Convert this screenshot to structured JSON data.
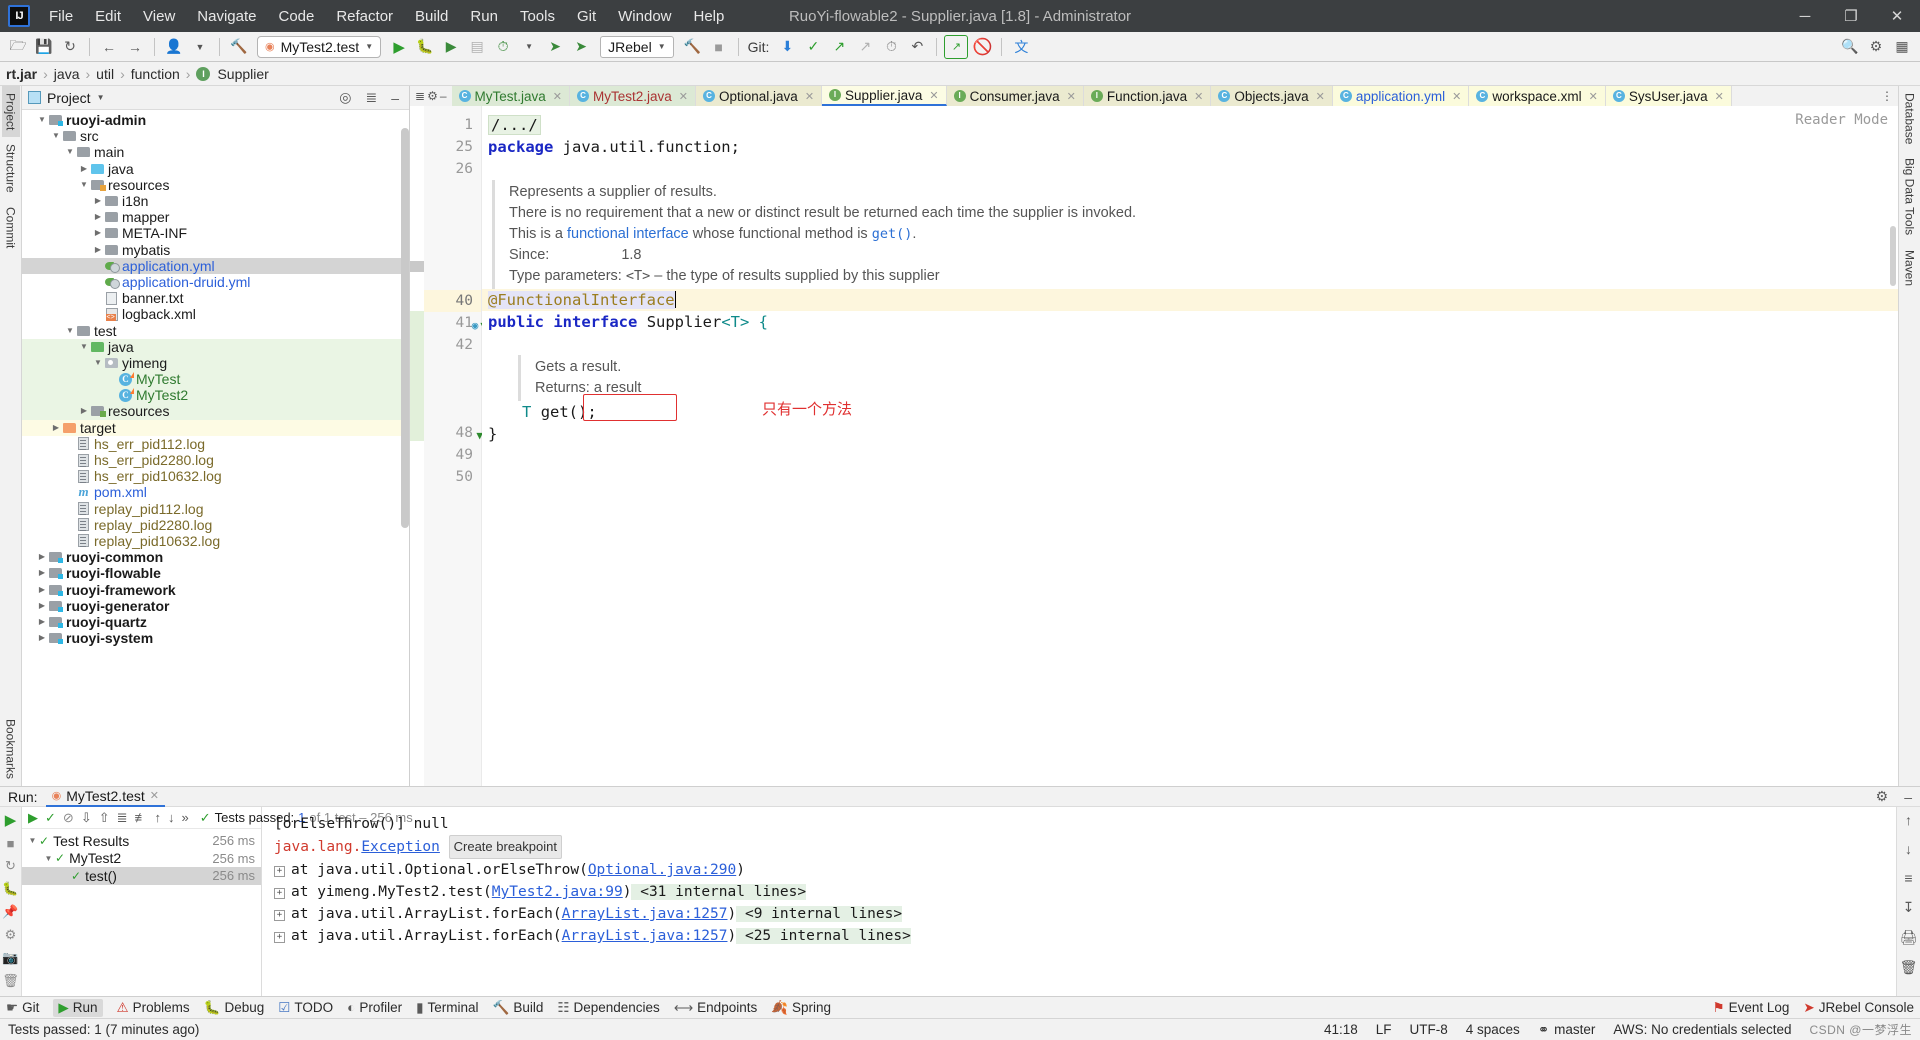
{
  "window": {
    "title": "RuoYi-flowable2 - Supplier.java [1.8] - Administrator",
    "minimize": "─",
    "maximize": "❐",
    "close": "✕"
  },
  "menubar": [
    "File",
    "Edit",
    "View",
    "Navigate",
    "Code",
    "Refactor",
    "Build",
    "Run",
    "Tools",
    "Git",
    "Window",
    "Help"
  ],
  "toolbar": {
    "open_icon": "open-folder-icon",
    "save_icon": "save-icon",
    "sync_icon": "sync-icon",
    "back_icon": "back-arrow-icon",
    "forward_icon": "forward-arrow-icon",
    "profile_icon": "user-profile-icon",
    "build_icon": "hammer-icon",
    "run_config": "MyTest2.test",
    "run_icon": "run-icon",
    "debug_icon": "debug-icon",
    "run_coverage_icon": "run-with-coverage-icon",
    "profiler_icon": "profiler-icon",
    "jrebel_label": "JRebel",
    "jrebel_run_icon": "jrebel-run-icon",
    "jrebel_debug_icon": "jrebel-debug-icon",
    "stop_icon": "stop-icon",
    "git_label": "Git:",
    "git_update_icon": "update-project-icon",
    "git_commit_icon": "commit-icon",
    "git_push_icon": "push-icon",
    "git_cherry_icon": "cherry-pick-icon",
    "history_icon": "history-icon",
    "rollback_icon": "rollback-icon",
    "search_everywhere_icon": "search-everywhere-icon",
    "settings_icon": "settings-icon",
    "project_structure_icon": "project-structure-icon",
    "translate_icon": "translate-icon"
  },
  "breadcrumb": {
    "items": [
      "rt.jar",
      "java",
      "util",
      "function"
    ],
    "current": "Supplier",
    "separator": "›"
  },
  "left_rail": [
    "Project",
    "Structure",
    "Commit",
    "Bookmarks"
  ],
  "right_rail": [
    "Database",
    "Big Data Tools",
    "Maven"
  ],
  "project_panel": {
    "title": "Project",
    "dropdown_icon": "chevron-down-icon",
    "locate_icon": "select-opened-file-icon",
    "collapse_icon": "collapse-all-icon",
    "hide_icon": "hide-icon",
    "tree": [
      {
        "depth": 1,
        "label": "ruoyi-admin",
        "icon": "module-folder",
        "arrow": "down",
        "style": "bold"
      },
      {
        "depth": 2,
        "label": "src",
        "icon": "folder",
        "arrow": "down",
        "style": ""
      },
      {
        "depth": 3,
        "label": "main",
        "icon": "folder",
        "arrow": "down",
        "style": ""
      },
      {
        "depth": 4,
        "label": "java",
        "icon": "source-folder",
        "arrow": "right",
        "style": ""
      },
      {
        "depth": 4,
        "label": "resources",
        "icon": "resource-folder",
        "arrow": "down",
        "style": ""
      },
      {
        "depth": 5,
        "label": "i18n",
        "icon": "folder",
        "arrow": "right",
        "style": ""
      },
      {
        "depth": 5,
        "label": "mapper",
        "icon": "folder",
        "arrow": "right",
        "style": ""
      },
      {
        "depth": 5,
        "label": "META-INF",
        "icon": "folder",
        "arrow": "right",
        "style": ""
      },
      {
        "depth": 5,
        "label": "mybatis",
        "icon": "folder",
        "arrow": "right",
        "style": ""
      },
      {
        "depth": 5,
        "label": "application.yml",
        "icon": "yml-file",
        "arrow": "",
        "style": "link",
        "selected": true
      },
      {
        "depth": 5,
        "label": "application-druid.yml",
        "icon": "yml-file",
        "arrow": "",
        "style": "link"
      },
      {
        "depth": 5,
        "label": "banner.txt",
        "icon": "txt-file",
        "arrow": "",
        "style": ""
      },
      {
        "depth": 5,
        "label": "logback.xml",
        "icon": "xml-file",
        "arrow": "",
        "style": ""
      },
      {
        "depth": 3,
        "label": "test",
        "icon": "folder",
        "arrow": "down",
        "style": ""
      },
      {
        "depth": 4,
        "label": "java",
        "icon": "test-source-folder",
        "arrow": "down",
        "style": "",
        "row": "test"
      },
      {
        "depth": 5,
        "label": "yimeng",
        "icon": "package-folder",
        "arrow": "down",
        "style": "",
        "row": "test"
      },
      {
        "depth": 6,
        "label": "MyTest",
        "icon": "class-file",
        "arrow": "",
        "style": "green",
        "row": "test"
      },
      {
        "depth": 6,
        "label": "MyTest2",
        "icon": "class-file",
        "arrow": "",
        "style": "green",
        "row": "test"
      },
      {
        "depth": 4,
        "label": "resources",
        "icon": "test-resource-folder",
        "arrow": "right",
        "style": "",
        "row": "test"
      },
      {
        "depth": 2,
        "label": "target",
        "icon": "target-folder",
        "arrow": "right",
        "style": "",
        "row": "target"
      },
      {
        "depth": 3,
        "label": "hs_err_pid112.log",
        "icon": "log-file",
        "arrow": "",
        "style": "olive"
      },
      {
        "depth": 3,
        "label": "hs_err_pid2280.log",
        "icon": "log-file",
        "arrow": "",
        "style": "olive"
      },
      {
        "depth": 3,
        "label": "hs_err_pid10632.log",
        "icon": "log-file",
        "arrow": "",
        "style": "olive"
      },
      {
        "depth": 3,
        "label": "pom.xml",
        "icon": "maven-file",
        "arrow": "",
        "style": "link"
      },
      {
        "depth": 3,
        "label": "replay_pid112.log",
        "icon": "log-file",
        "arrow": "",
        "style": "olive"
      },
      {
        "depth": 3,
        "label": "replay_pid2280.log",
        "icon": "log-file",
        "arrow": "",
        "style": "olive"
      },
      {
        "depth": 3,
        "label": "replay_pid10632.log",
        "icon": "log-file",
        "arrow": "",
        "style": "olive"
      },
      {
        "depth": 1,
        "label": "ruoyi-common",
        "icon": "module-folder",
        "arrow": "right",
        "style": "bold"
      },
      {
        "depth": 1,
        "label": "ruoyi-flowable",
        "icon": "module-folder",
        "arrow": "right",
        "style": "bold"
      },
      {
        "depth": 1,
        "label": "ruoyi-framework",
        "icon": "module-folder",
        "arrow": "right",
        "style": "bold"
      },
      {
        "depth": 1,
        "label": "ruoyi-generator",
        "icon": "module-folder",
        "arrow": "right",
        "style": "bold"
      },
      {
        "depth": 1,
        "label": "ruoyi-quartz",
        "icon": "module-folder",
        "arrow": "right",
        "style": "bold"
      },
      {
        "depth": 1,
        "label": "ruoyi-system",
        "icon": "module-folder",
        "arrow": "right",
        "style": "bold"
      }
    ]
  },
  "editor": {
    "tabs": [
      {
        "label": "MyTest.java",
        "icon": "class-icon",
        "color": "green",
        "bg": "green",
        "active": false
      },
      {
        "label": "MyTest2.java",
        "icon": "class-icon",
        "color": "red",
        "bg": "green",
        "active": false
      },
      {
        "label": "Optional.java",
        "icon": "class-icon",
        "color": "dark",
        "bg": "yellow",
        "active": false
      },
      {
        "label": "Supplier.java",
        "icon": "interface-icon",
        "color": "dark",
        "bg": "active",
        "active": true
      },
      {
        "label": "Consumer.java",
        "icon": "interface-icon",
        "color": "dark",
        "bg": "yellow",
        "active": false
      },
      {
        "label": "Function.java",
        "icon": "interface-icon",
        "color": "dark",
        "bg": "yellow",
        "active": false
      },
      {
        "label": "Objects.java",
        "icon": "class-icon",
        "color": "dark",
        "bg": "yellow",
        "active": false
      },
      {
        "label": "application.yml",
        "icon": "yml-icon",
        "color": "blue",
        "bg": "lyellow",
        "active": false
      },
      {
        "label": "workspace.xml",
        "icon": "xml-icon",
        "color": "dark",
        "bg": "lyellow",
        "active": false
      },
      {
        "label": "SysUser.java",
        "icon": "class-icon",
        "color": "dark",
        "bg": "lyellow",
        "active": false
      }
    ],
    "more_icon": "more-tabs-icon",
    "reader_mode": "Reader Mode",
    "line_numbers": [
      "1",
      "25",
      "26",
      "",
      "",
      "",
      "",
      "",
      "40",
      "41",
      "42",
      "",
      "",
      "",
      "48",
      "49",
      "50"
    ],
    "gutter_lines": [
      {
        "num": "1"
      },
      {
        "num": "25"
      },
      {
        "num": "26"
      },
      {
        "num": "40",
        "current": true
      },
      {
        "num": "41",
        "icons": [
          "implemented-icon",
          "implementing-method-icon"
        ]
      },
      {
        "num": "42"
      },
      {
        "num": "48",
        "icons": [
          "implementing-method-icon"
        ]
      },
      {
        "num": "49"
      },
      {
        "num": "50"
      }
    ],
    "code": {
      "fold_placeholder": "/.../",
      "package_keyword": "package",
      "package_name": " java.util.function;",
      "javadoc_class": [
        "Represents a supplier of results.",
        "There is no requirement that a new or distinct result be returned each time the supplier is invoked.",
        "This is a functional interface whose functional method is get().",
        "Since:                1.8",
        "Type parameters:  <T> – the type of results supplied by this supplier"
      ],
      "javadoc_links": [
        "functional interface",
        "get()"
      ],
      "annotation": "@FunctionalInterface",
      "declaration_kw1": "public",
      "declaration_kw2": "interface",
      "declaration_name": "Supplier",
      "declaration_generic": "<T> {",
      "javadoc_method": [
        "Gets a result.",
        "Returns: a result"
      ],
      "method_signature": "T get();",
      "closing_brace": "}",
      "annotation_note": "只有一个方法"
    }
  },
  "run_panel": {
    "run_label": "Run:",
    "tab_label": "MyTest2.test",
    "tab_close_icon": "close-icon",
    "settings_icon": "gear-icon",
    "hide_icon": "hide-icon",
    "toolbar": {
      "rerun_icon": "rerun-icon",
      "toggle_passed_icon": "hide-passed-icon",
      "toggle_ignored_icon": "hide-ignored-icon",
      "sort_alpha_icon": "sort-alphabetically-icon",
      "sort_duration_icon": "sort-by-duration-icon",
      "expand_icon": "expand-all-icon",
      "collapse_icon": "collapse-all-icon",
      "prev_icon": "prev-failed-icon",
      "next_icon": "next-failed-icon",
      "more_icon": "more-icon"
    },
    "status": {
      "check_icon": "check-icon",
      "passed_label": "Tests passed:",
      "passed_detail": "1",
      "passed_rest": " of 1 test – 256 ms"
    },
    "tests": [
      {
        "depth": 0,
        "label": "Test Results",
        "time": "256 ms",
        "arrow": "down"
      },
      {
        "depth": 1,
        "label": "MyTest2",
        "time": "256 ms",
        "arrow": "down"
      },
      {
        "depth": 2,
        "label": "test()",
        "time": "256 ms",
        "arrow": "",
        "selected": true
      }
    ],
    "console": [
      {
        "text": "[orElseThrow()] null",
        "type": "plain"
      },
      {
        "text": "java.lang.Exception",
        "type": "exception",
        "chip": "Create breakpoint"
      },
      {
        "text": "at java.util.Optional.orElseThrow(Optional.java:290)",
        "type": "stack",
        "link": "Optional.java:290",
        "expander": true
      },
      {
        "text": "at yimeng.MyTest2.test(MyTest2.java:99) <31 internal lines>",
        "type": "stack",
        "link": "MyTest2.java:99",
        "tail": "<31 internal lines>",
        "expander": true
      },
      {
        "text": "at java.util.ArrayList.forEach(ArrayList.java:1257) <9 internal lines>",
        "type": "stack",
        "link": "ArrayList.java:1257",
        "tail": "<9 internal lines>",
        "expander": true
      },
      {
        "text": "at java.util.ArrayList.forEach(ArrayList.java:1257) <25 internal lines>",
        "type": "stack",
        "link": "ArrayList.java:1257",
        "tail": "<25 internal lines>",
        "expander": true
      }
    ],
    "right_icons": [
      "scroll-up-icon",
      "scroll-down-icon",
      "soft-wrap-icon",
      "scroll-to-end-icon",
      "print-icon",
      "clear-all-icon"
    ]
  },
  "bottom_strip": {
    "items": [
      {
        "label": "Git",
        "icon": "git-icon"
      },
      {
        "label": "Run",
        "icon": "run-icon",
        "active": true
      },
      {
        "label": "Problems",
        "icon": "problems-icon"
      },
      {
        "label": "Debug",
        "icon": "debug-icon"
      },
      {
        "label": "TODO",
        "icon": "todo-icon"
      },
      {
        "label": "Profiler",
        "icon": "profiler-icon"
      },
      {
        "label": "Terminal",
        "icon": "terminal-icon"
      },
      {
        "label": "Build",
        "icon": "build-icon"
      },
      {
        "label": "Dependencies",
        "icon": "dependencies-icon"
      },
      {
        "label": "Endpoints",
        "icon": "endpoints-icon"
      },
      {
        "label": "Spring",
        "icon": "spring-icon"
      }
    ],
    "right": [
      {
        "label": "Event Log",
        "icon": "event-log-icon"
      },
      {
        "label": "JRebel Console",
        "icon": "jrebel-icon"
      }
    ]
  },
  "statusbar": {
    "message": "Tests passed: 1 (7 minutes ago)",
    "caret_position": "41:18",
    "line_separator": "LF",
    "encoding": "UTF-8",
    "indent": "4 spaces",
    "branch": "master",
    "branch_icon": "branch-icon",
    "aws": "AWS: No credentials selected",
    "watermark": "CSDN @一梦浮生"
  }
}
